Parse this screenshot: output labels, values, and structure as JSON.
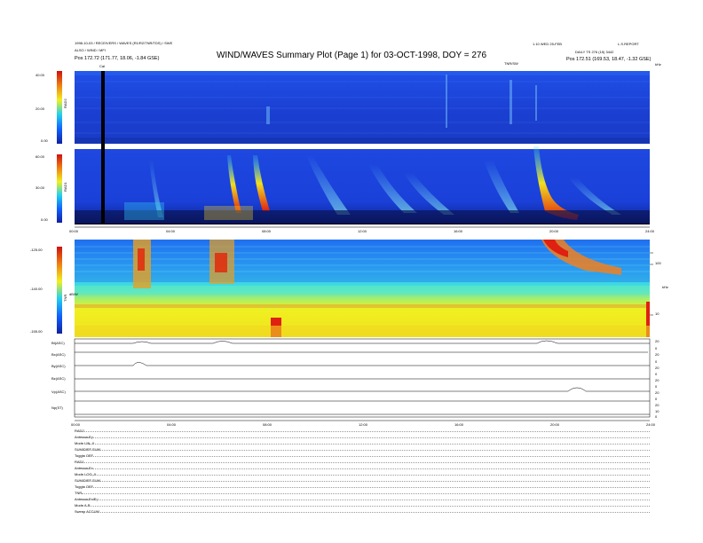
{
  "header": {
    "title": "WIND/WAVES Summary Plot (Page 1) for 03-OCT-1998, DOY = 276",
    "left_line1": "1998-10-03 / RECEIVERS / WAVES (R1/R2/TNR/TDS) / SWE",
    "left_line2": "ALSO / WIND / MFI",
    "left_pos": "Pos   172.72 (171.77, 18.06, -1.84 GSE)",
    "right_line1": "1.10 WED 25-FEB",
    "right_line2": "L.S.REPORT",
    "right_line3": "DAILY TS 276 (15) 3442",
    "right_pos": "Pos   172.51 (169.53, 18.47, -1.32 GSE)",
    "cal_marker": "Cal",
    "tnr_scale_label": "TNR/SW",
    "tnr_units": "kHz",
    "tnr_freq_unit": "kHz",
    "tnr_power_label": "dB/W"
  },
  "colors": {
    "background_blue": "#1e3fcf",
    "burst_red": "#e02010",
    "tnr_yellow": "#e8e020",
    "tnr_cyan": "#40d8e0"
  },
  "chart_data": [
    {
      "type": "heatmap",
      "panel": "RAD2",
      "ylabel": "RAD2",
      "y_ticks": [
        "40.00",
        "20.00",
        "0.00"
      ],
      "ylim": [
        0,
        40
      ]
    },
    {
      "type": "heatmap",
      "panel": "RAD1",
      "ylabel": "RAD1",
      "y_ticks": [
        "60.00",
        "30.00",
        "0.00"
      ],
      "ylim": [
        0,
        60
      ],
      "x_ticks": [
        "00:00",
        "04:00",
        "08:00",
        "12:00",
        "16:00",
        "20:00",
        "24:00"
      ]
    },
    {
      "type": "heatmap",
      "panel": "TNR",
      "ylabel": "TNR",
      "y_ticks": [
        "-125.00",
        "-140.00",
        "-155.00"
      ],
      "right_ticks": [
        "100",
        "10"
      ]
    },
    {
      "type": "line",
      "panel": "magnetic field / plasma",
      "series": [
        {
          "name": "Bt(ASC)"
        },
        {
          "name": "Bx(ASC)"
        },
        {
          "name": "By(ASC)"
        },
        {
          "name": "Bz(ASC)"
        },
        {
          "name": "Vp(ASC)"
        },
        {
          "name": "Np(ST)"
        }
      ],
      "right_ticks": [
        "20",
        "0",
        "20",
        "0",
        "20",
        "0",
        "20",
        "0",
        "20",
        "0",
        "20",
        "10",
        "0"
      ],
      "x_ticks": [
        "00:00",
        "04:00",
        "08:00",
        "12:00",
        "16:00",
        "20:00",
        "24:00"
      ]
    }
  ],
  "settings": [
    {
      "label": "RAD2",
      "value": ""
    },
    {
      "label": "Antenna",
      "value": "Ey"
    },
    {
      "label": "Mode",
      "value": "LIN, X"
    },
    {
      "label": "SUM/DIFF",
      "value": "SUM"
    },
    {
      "label": "Toggle",
      "value": "OFF"
    },
    {
      "label": "RAD1",
      "value": ""
    },
    {
      "label": "Antenna",
      "value": "Ex"
    },
    {
      "label": "Mode",
      "value": "LOG, X"
    },
    {
      "label": "SUM/DIFF",
      "value": "SUM"
    },
    {
      "label": "Toggle",
      "value": "OFF"
    },
    {
      "label": "TNR",
      "value": ""
    },
    {
      "label": "Antenna",
      "value": "Ex/Ey"
    },
    {
      "label": "Mode",
      "value": "A-B"
    },
    {
      "label": "Sweep",
      "value": "ACCUM"
    }
  ]
}
